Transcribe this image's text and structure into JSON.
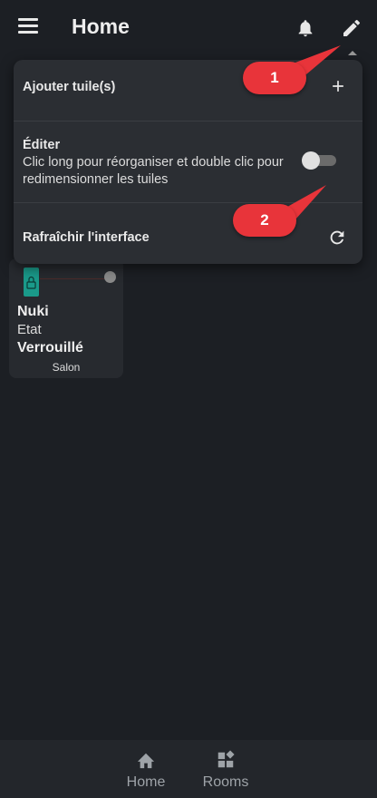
{
  "app_bar": {
    "title": "Home",
    "menu_icon": "menu-icon",
    "notifications_icon": "bell-icon",
    "edit_icon": "pencil-icon"
  },
  "tile": {
    "name": "Nuki",
    "state_label": "Etat",
    "state": "Verrouillé",
    "room": "Salon",
    "icon": "lock-icon"
  },
  "menu": {
    "add_tiles": {
      "label": "Ajouter tuile(s)",
      "icon": "plus-icon"
    },
    "edit": {
      "label": "Éditer",
      "description": "Clic long pour réorganiser et double clic pour redimensionner les tuiles",
      "toggle_on": false
    },
    "refresh": {
      "label": "Rafraîchir l'interface",
      "icon": "refresh-icon"
    }
  },
  "callouts": {
    "first": "1",
    "second": "2",
    "color": "#e8343a"
  },
  "bottom_nav": {
    "home": {
      "label": "Home",
      "icon": "home-icon"
    },
    "rooms": {
      "label": "Rooms",
      "icon": "dashboard-icon"
    }
  },
  "colors": {
    "background": "#1c1f24",
    "menu_bg": "#2b2e33",
    "accent_teal": "#1a9a8a"
  }
}
